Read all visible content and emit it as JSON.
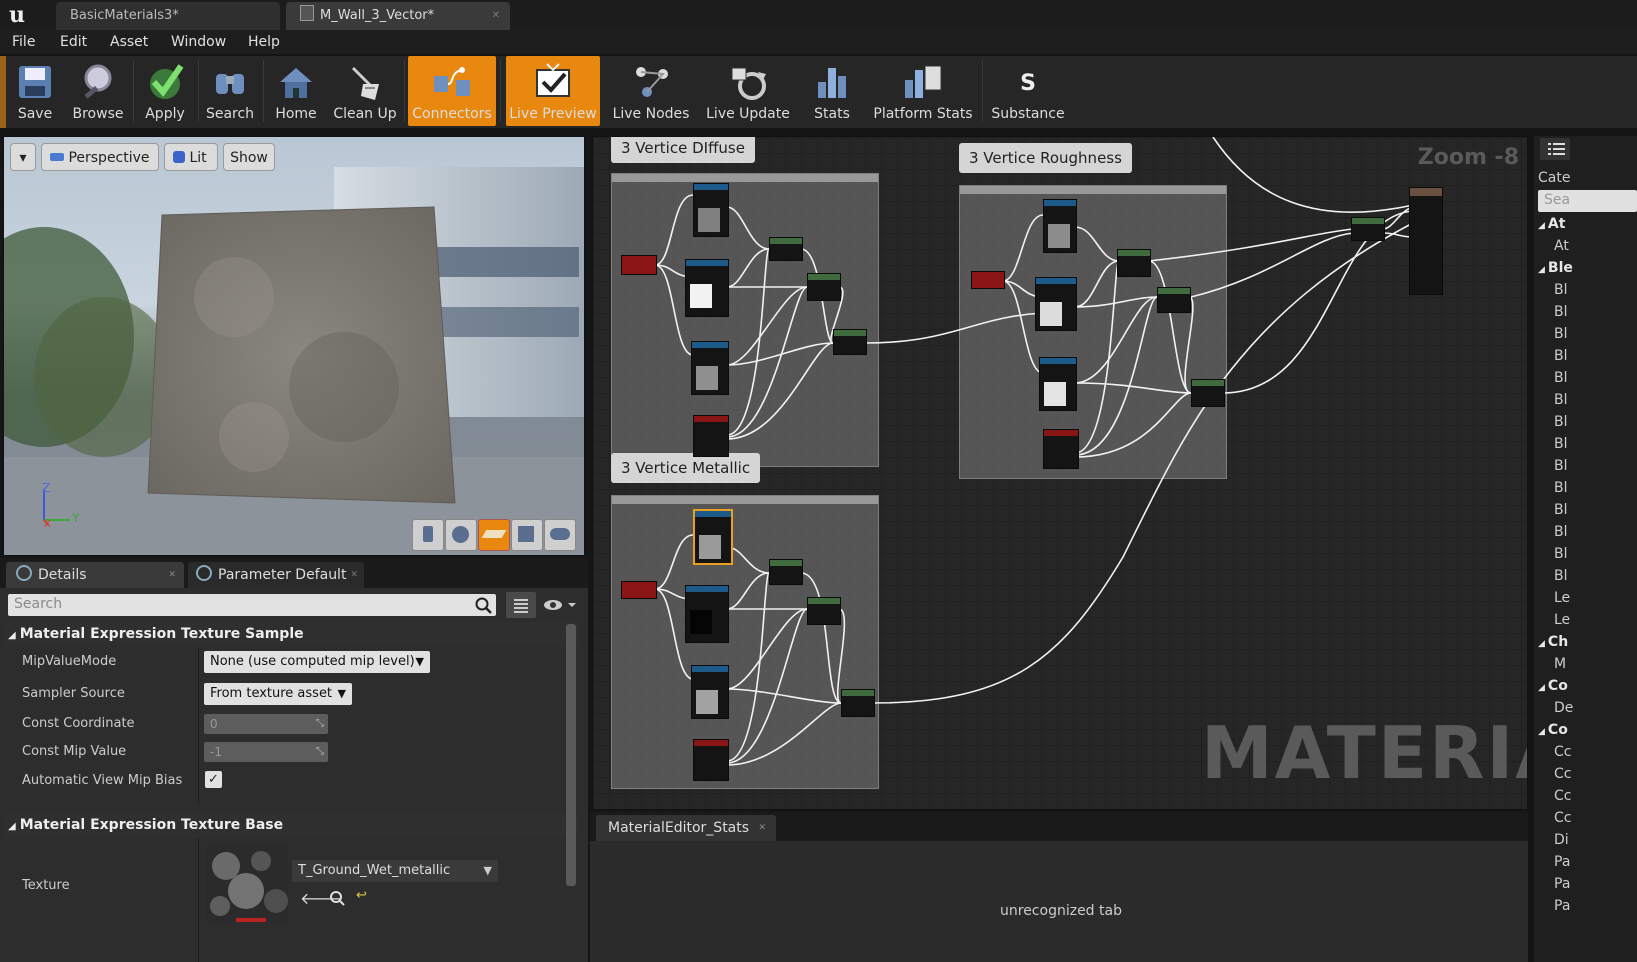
{
  "titlebar": {
    "logo": "u",
    "tabs": [
      {
        "label": "BasicMaterials3*"
      },
      {
        "label": "M_Wall_3_Vector*"
      }
    ]
  },
  "menu": [
    "File",
    "Edit",
    "Asset",
    "Window",
    "Help"
  ],
  "toolbar": {
    "buttons": [
      {
        "label": "Save",
        "icon": "save-icon"
      },
      {
        "label": "Browse",
        "icon": "browse-icon"
      },
      {
        "label": "Apply",
        "icon": "apply-check-icon"
      },
      {
        "label": "Search",
        "icon": "binoculars-icon"
      },
      {
        "label": "Home",
        "icon": "home-icon"
      },
      {
        "label": "Clean Up",
        "icon": "broom-icon"
      },
      {
        "label": "Connectors",
        "icon": "connectors-icon",
        "active": true
      },
      {
        "label": "Live Preview",
        "icon": "live-preview-icon",
        "active": true
      },
      {
        "label": "Live Nodes",
        "icon": "live-nodes-icon"
      },
      {
        "label": "Live Update",
        "icon": "live-update-icon"
      },
      {
        "label": "Stats",
        "icon": "stats-icon"
      },
      {
        "label": "Platform Stats",
        "icon": "platform-stats-icon"
      },
      {
        "label": "Substance",
        "icon": "substance-icon"
      }
    ],
    "active_color": "#e8880f"
  },
  "viewport": {
    "menu_caret": "▾",
    "perspective": "Perspective",
    "lit": "Lit",
    "show": "Show",
    "axis_z": "Z",
    "axis_y": "Y",
    "axis_x": "X",
    "preview_shapes": [
      "cylinder-icon",
      "sphere-icon",
      "plane-icon",
      "cube-icon",
      "teapot-icon"
    ]
  },
  "details": {
    "tabs": [
      {
        "label": "Details"
      },
      {
        "label": "Parameter Default"
      }
    ],
    "search_placeholder": "Search",
    "sections": [
      {
        "title": "Material Expression Texture Sample",
        "props": [
          {
            "label": "MipValueMode",
            "value": "None (use computed mip level)"
          },
          {
            "label": "Sampler Source",
            "value": "From texture asset"
          },
          {
            "label": "Const Coordinate",
            "value": "0"
          },
          {
            "label": "Const Mip Value",
            "value": "-1"
          },
          {
            "label": "Automatic View Mip Bias",
            "checked": true
          }
        ]
      },
      {
        "title": "Material Expression Texture Base",
        "props": [
          {
            "label": "Texture",
            "value": "T_Ground_Wet_metallic"
          }
        ]
      }
    ]
  },
  "graph": {
    "zoom": "Zoom -8",
    "watermark": "MATERIAL",
    "comments": [
      {
        "title": "3 Vertice DIffuse"
      },
      {
        "title": "3 Vertice Roughness"
      },
      {
        "title": "3 Vertice Metallic"
      }
    ]
  },
  "stats": {
    "tab": "MaterialEditor_Stats",
    "body": "unrecognized tab"
  },
  "palette": {
    "partial_items": [
      {
        "text": "Cate",
        "kind": "label"
      },
      {
        "text": "Sea",
        "kind": "search"
      },
      {
        "text": "At",
        "kind": "cat"
      },
      {
        "text": "At",
        "kind": "item"
      },
      {
        "text": "Ble",
        "kind": "cat"
      },
      {
        "text": "Bl",
        "kind": "item"
      },
      {
        "text": "Bl",
        "kind": "item"
      },
      {
        "text": "Bl",
        "kind": "item"
      },
      {
        "text": "Bl",
        "kind": "item"
      },
      {
        "text": "Bl",
        "kind": "item"
      },
      {
        "text": "Bl",
        "kind": "item"
      },
      {
        "text": "Bl",
        "kind": "item"
      },
      {
        "text": "Bl",
        "kind": "item"
      },
      {
        "text": "Bl",
        "kind": "item"
      },
      {
        "text": "Bl",
        "kind": "item"
      },
      {
        "text": "Bl",
        "kind": "item"
      },
      {
        "text": "Bl",
        "kind": "item"
      },
      {
        "text": "Bl",
        "kind": "item"
      },
      {
        "text": "Bl",
        "kind": "item"
      },
      {
        "text": "Le",
        "kind": "item"
      },
      {
        "text": "Le",
        "kind": "item"
      },
      {
        "text": "Ch",
        "kind": "cat"
      },
      {
        "text": "M",
        "kind": "item"
      },
      {
        "text": "Co",
        "kind": "cat"
      },
      {
        "text": "De",
        "kind": "item"
      },
      {
        "text": "Co",
        "kind": "cat"
      },
      {
        "text": "Cc",
        "kind": "item"
      },
      {
        "text": "Cc",
        "kind": "item"
      },
      {
        "text": "Cc",
        "kind": "item"
      },
      {
        "text": "Cc",
        "kind": "item"
      },
      {
        "text": "Di",
        "kind": "item"
      },
      {
        "text": "Pa",
        "kind": "item"
      },
      {
        "text": "Pa",
        "kind": "item"
      },
      {
        "text": "Pa",
        "kind": "item"
      }
    ]
  }
}
